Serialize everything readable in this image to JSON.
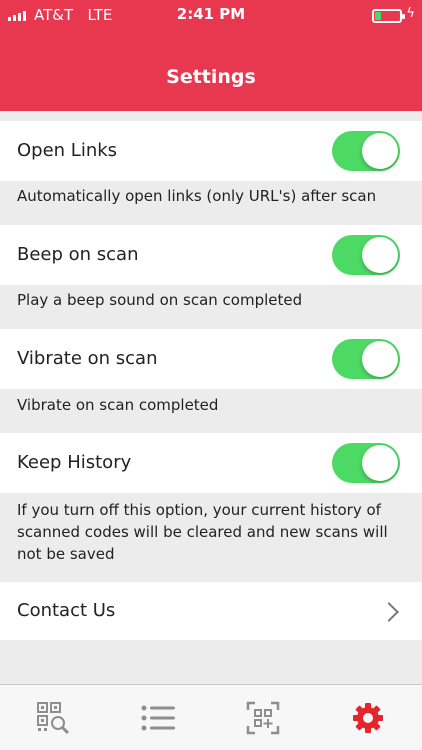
{
  "status_bar": {
    "carrier": "AT&T",
    "network": "LTE",
    "time": "2:41 PM"
  },
  "header": {
    "title": "Settings"
  },
  "settings": [
    {
      "label": "Open Links",
      "description": "Automatically open links (only URL's) after scan",
      "enabled": true
    },
    {
      "label": "Beep on scan",
      "description": "Play a beep sound on scan completed",
      "enabled": true
    },
    {
      "label": "Vibrate on scan",
      "description": "Vibrate on scan completed",
      "enabled": true
    },
    {
      "label": "Keep History",
      "description": "If you turn off this option, your current history of scanned codes will be cleared and new scans will not be saved",
      "enabled": true
    }
  ],
  "contact": {
    "label": "Contact Us"
  },
  "tab_bar": {
    "tabs": [
      {
        "icon": "qr-search-icon",
        "active": false
      },
      {
        "icon": "list-icon",
        "active": false
      },
      {
        "icon": "qr-create-icon",
        "active": false
      },
      {
        "icon": "gear-icon",
        "active": true
      }
    ]
  },
  "colors": {
    "brand": "#e8384f",
    "toggle_on": "#4cd964",
    "tab_inactive": "#8e8e8e",
    "tab_active": "#e3262e"
  }
}
